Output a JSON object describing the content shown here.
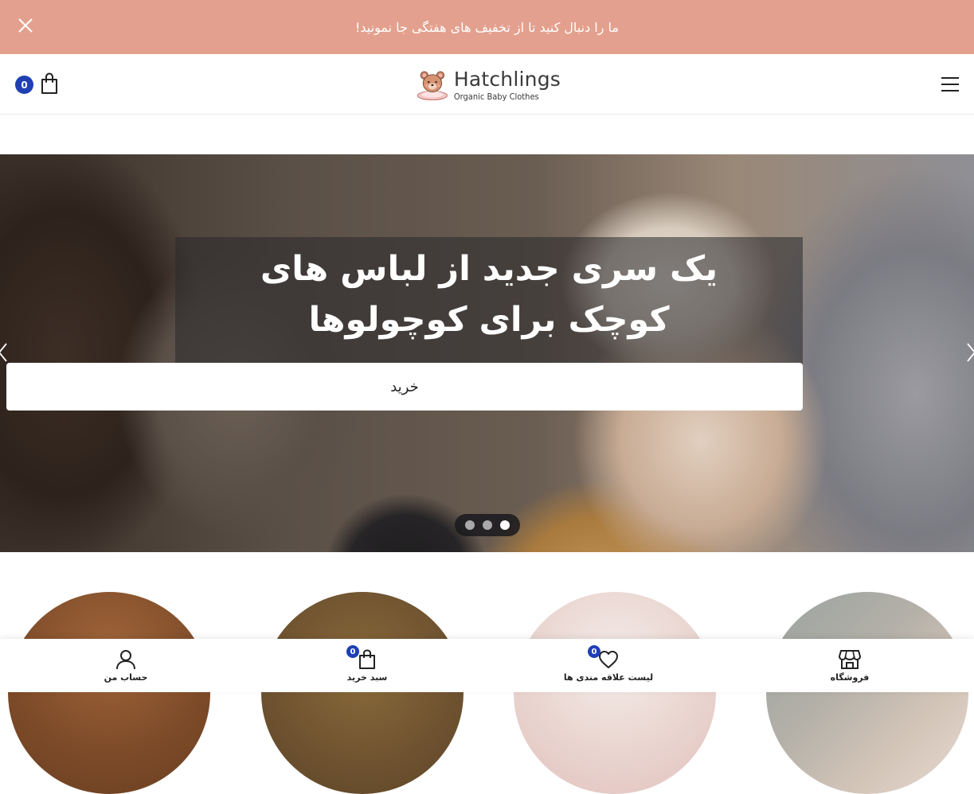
{
  "promo": {
    "text": "ما را دنبال کنید تا از تخفیف های هفتگی جا نمونید!",
    "background": "#e4a08e"
  },
  "header": {
    "cart_count": "0",
    "logo_name": "Hatchlings",
    "logo_tagline": "Organic Baby Clothes",
    "icons": [
      "shopping-bag-icon",
      "hamburger-menu-icon",
      "close-icon"
    ]
  },
  "hero": {
    "title_line1": "یک سری جدید از لباس های",
    "title_line2": "کوچک برای کوچولوها",
    "button_label": "خرید",
    "slides_count": 3,
    "active_slide": 3
  },
  "categories": [
    {
      "name": "category-1"
    },
    {
      "name": "category-2"
    },
    {
      "name": "category-3"
    },
    {
      "name": "category-4"
    }
  ],
  "bottom_nav": {
    "account_label": "حساب من",
    "cart_label": "سبد خرید",
    "cart_count": "0",
    "wishlist_label": "لیست علاقه مندی ها",
    "wishlist_count": "0",
    "shop_label": "فروشگاه"
  },
  "colors": {
    "accent_badge": "#1f3fb3",
    "promo": "#e4a08e"
  }
}
